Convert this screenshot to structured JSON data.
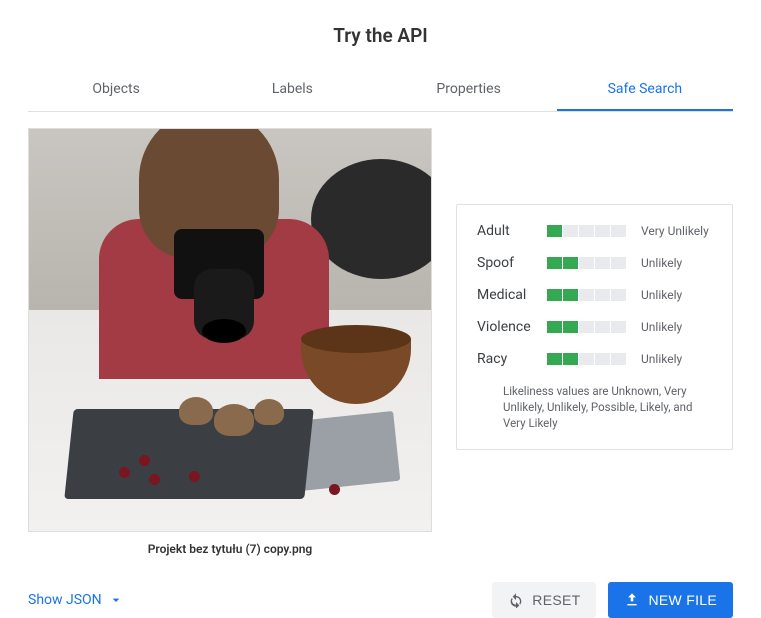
{
  "title": "Try the API",
  "tabs": [
    {
      "label": "Objects",
      "active": false
    },
    {
      "label": "Labels",
      "active": false
    },
    {
      "label": "Properties",
      "active": false
    },
    {
      "label": "Safe Search",
      "active": true
    }
  ],
  "image": {
    "filename": "Projekt bez tytułu (7) copy.png"
  },
  "safe_search": {
    "categories": [
      {
        "label": "Adult",
        "level": 1,
        "value": "Very Unlikely"
      },
      {
        "label": "Spoof",
        "level": 2,
        "value": "Unlikely"
      },
      {
        "label": "Medical",
        "level": 2,
        "value": "Unlikely"
      },
      {
        "label": "Violence",
        "level": 2,
        "value": "Unlikely"
      },
      {
        "label": "Racy",
        "level": 2,
        "value": "Unlikely"
      }
    ],
    "total_levels": 5,
    "footnote": "Likeliness values are Unknown, Very Unlikely, Unlikely, Possible, Likely, and Very Likely"
  },
  "actions": {
    "show_json": "Show JSON",
    "reset": "RESET",
    "new_file": "NEW FILE"
  }
}
